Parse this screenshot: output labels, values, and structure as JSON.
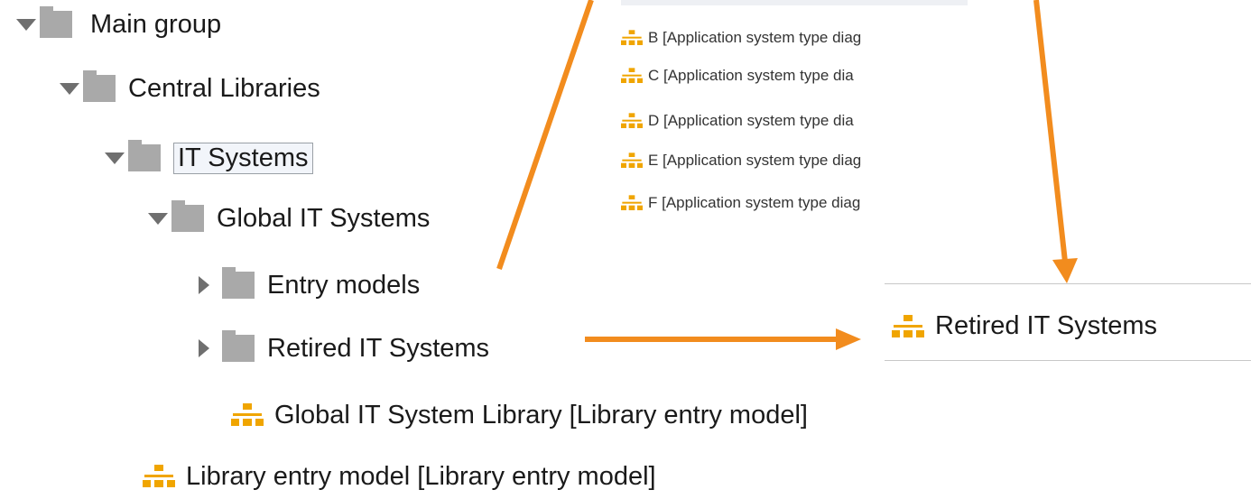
{
  "tree": {
    "items": [
      {
        "label": "Main group",
        "icon": "folder-icon",
        "toggle": "expanded"
      },
      {
        "label": "Central Libraries",
        "icon": "folder-icon",
        "toggle": "expanded"
      },
      {
        "label": "IT Systems",
        "icon": "folder-icon",
        "toggle": "expanded",
        "selected": true
      },
      {
        "label": "Global IT Systems",
        "icon": "folder-icon",
        "toggle": "expanded"
      },
      {
        "label": "Entry models",
        "icon": "folder-icon",
        "toggle": "collapsed"
      },
      {
        "label": "Retired IT Systems",
        "icon": "folder-icon",
        "toggle": "collapsed"
      },
      {
        "label": "Global IT System Library [Library entry model]",
        "icon": "model-icon"
      },
      {
        "label": "Library entry model [Library entry model]",
        "icon": "model-icon"
      }
    ]
  },
  "model_list": {
    "items": [
      {
        "label": "B [Application system type diag",
        "icon": "model-icon"
      },
      {
        "label": "C [Application system type dia",
        "icon": "model-icon"
      },
      {
        "label": "D [Application system type dia",
        "icon": "model-icon"
      },
      {
        "label": "E [Application system type diag",
        "icon": "model-icon"
      },
      {
        "label": "F [Application system type diag",
        "icon": "model-icon"
      }
    ]
  },
  "detail": {
    "label": "Retired IT Systems",
    "icon": "model-icon"
  },
  "colors": {
    "arrow": "#f28c1e",
    "model_icon": "#f0a500",
    "folder": "#a9a9a9"
  }
}
